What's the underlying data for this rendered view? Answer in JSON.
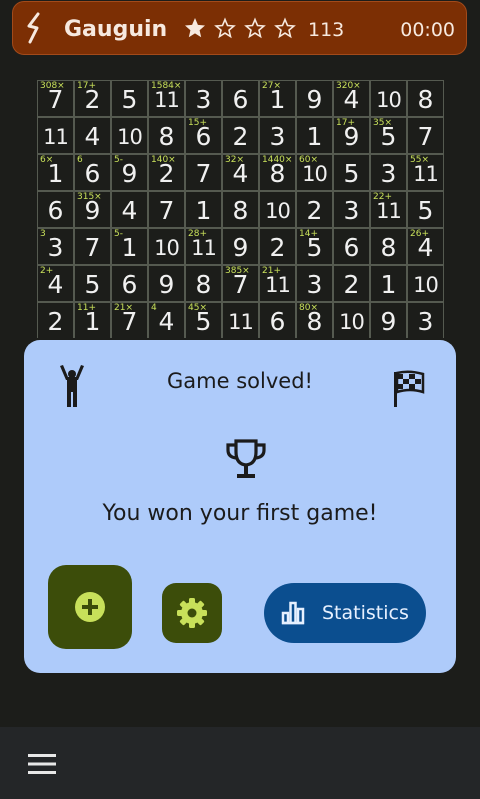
{
  "header": {
    "title": "Gauguin",
    "difficulty_stars": 1,
    "difficulty_max": 4,
    "count": "113",
    "timer": "00:00",
    "colors": {
      "bar": "#7c2f04",
      "text": "#f7e9df"
    }
  },
  "grid": {
    "size": 11,
    "visible_rows": 7,
    "rows": [
      [
        "7",
        "2",
        "5",
        "11",
        "3",
        "6",
        "1",
        "9",
        "4",
        "10",
        "8"
      ],
      [
        "11",
        "4",
        "10",
        "8",
        "6",
        "2",
        "3",
        "1",
        "9",
        "5",
        "7"
      ],
      [
        "1",
        "6",
        "9",
        "2",
        "7",
        "4",
        "8",
        "10",
        "5",
        "3",
        "11"
      ],
      [
        "6",
        "9",
        "4",
        "7",
        "1",
        "8",
        "10",
        "2",
        "3",
        "11",
        "5"
      ],
      [
        "3",
        "7",
        "1",
        "10",
        "11",
        "9",
        "2",
        "5",
        "6",
        "8",
        "4"
      ],
      [
        "4",
        "5",
        "6",
        "9",
        "8",
        "7",
        "11",
        "3",
        "2",
        "1",
        "10"
      ],
      [
        "2",
        "1",
        "7",
        "4",
        "5",
        "11",
        "6",
        "8",
        "10",
        "9",
        "3"
      ]
    ],
    "cages": [
      [
        "308×",
        "17+",
        "",
        "1584×",
        "",
        "",
        "27×",
        "",
        "320×",
        "",
        ""
      ],
      [
        "",
        "",
        "",
        "",
        "15+",
        "",
        "",
        "",
        "17+",
        "35×",
        ""
      ],
      [
        "6×",
        "6",
        "5-",
        "140×",
        "",
        "32×",
        "1440×",
        "60×",
        "",
        "",
        "55×"
      ],
      [
        "",
        "315×",
        "",
        "",
        "",
        "",
        "",
        "",
        "",
        "22+",
        ""
      ],
      [
        "3",
        "",
        "5-",
        "",
        "28+",
        "",
        "",
        "14+",
        "",
        "",
        "26+"
      ],
      [
        "2+",
        "",
        "",
        "",
        "",
        "385×",
        "21+",
        "",
        "",
        "",
        ""
      ],
      [
        "",
        "11+",
        "21×",
        "4",
        "45×",
        "",
        "",
        "80×",
        "",
        "",
        ""
      ]
    ],
    "cage_color": "#c8e05a"
  },
  "dialog": {
    "title": "Game solved!",
    "message": "You won your first game!",
    "new_game_icon": "plus-circle-icon",
    "settings_icon": "gear-icon",
    "statistics_label": "Statistics",
    "colors": {
      "panel": "#aecbfa",
      "button_dark": "#3c4d0a",
      "button_blue": "#0b4e8f",
      "icon_lime": "#c8e05a"
    }
  },
  "bottombar": {
    "menu_icon": "hamburger-menu-icon"
  }
}
